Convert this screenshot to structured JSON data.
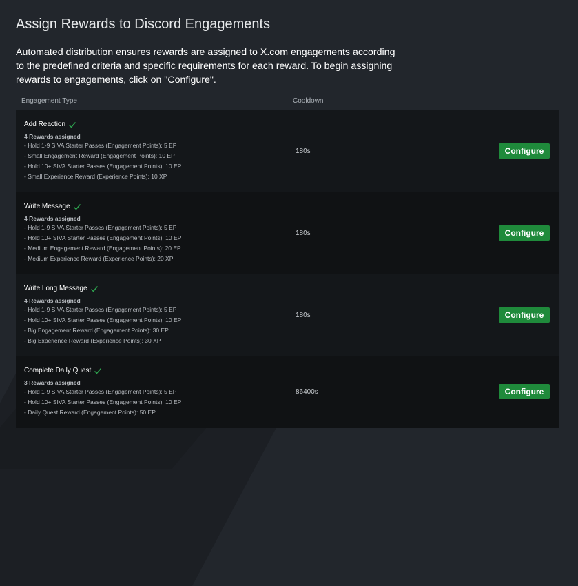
{
  "header": {
    "title": "Assign Rewards to Discord Engagements",
    "description": "Automated distribution ensures rewards are assigned to X.com engagements according to the predefined criteria and specific requirements for each reward. To begin assigning rewards to engagements, click on \"Configure\"."
  },
  "table": {
    "columns": {
      "type": "Engagement Type",
      "cooldown": "Cooldown"
    },
    "rows": [
      {
        "name": "Add Reaction",
        "rewards_count": "4 Rewards assigned",
        "rewards": [
          "- Hold 1-9 SIVA Starter Passes (Engagement Points): 5 EP",
          "- Small Engagement Reward (Engagement Points): 10 EP",
          "- Hold 10+ SIVA Starter Passes (Engagement Points): 10 EP",
          "- Small Experience Reward (Experience Points): 10 XP"
        ],
        "cooldown": "180s",
        "button": "Configure"
      },
      {
        "name": "Write Message",
        "rewards_count": "4 Rewards assigned",
        "rewards": [
          "- Hold 1-9 SIVA Starter Passes (Engagement Points): 5 EP",
          "- Hold 10+ SIVA Starter Passes (Engagement Points): 10 EP",
          "- Medium Engagement Reward (Engagement Points): 20 EP",
          "- Medium Experience Reward (Experience Points): 20 XP"
        ],
        "cooldown": "180s",
        "button": "Configure"
      },
      {
        "name": "Write Long Message",
        "rewards_count": "4 Rewards assigned",
        "rewards": [
          "- Hold 1-9 SIVA Starter Passes (Engagement Points): 5 EP",
          "- Hold 10+ SIVA Starter Passes (Engagement Points): 10 EP",
          "- Big Engagement Reward (Engagement Points): 30 EP",
          "- Big Experience Reward (Experience Points): 30 XP"
        ],
        "cooldown": "180s",
        "button": "Configure"
      },
      {
        "name": "Complete Daily Quest",
        "rewards_count": "3 Rewards assigned",
        "rewards": [
          "- Hold 1-9 SIVA Starter Passes (Engagement Points): 5 EP",
          "- Hold 10+ SIVA Starter Passes (Engagement Points): 10 EP",
          "- Daily Quest Reward (Engagement Points): 50 EP"
        ],
        "cooldown": "86400s",
        "button": "Configure"
      }
    ]
  },
  "colors": {
    "background": "#22262c",
    "row_dark": "#14171a",
    "row_darker": "#101214",
    "accent_green": "#1f8a3b",
    "check_green": "#2ea44f"
  },
  "icons": {
    "status": "checkmark-icon"
  }
}
